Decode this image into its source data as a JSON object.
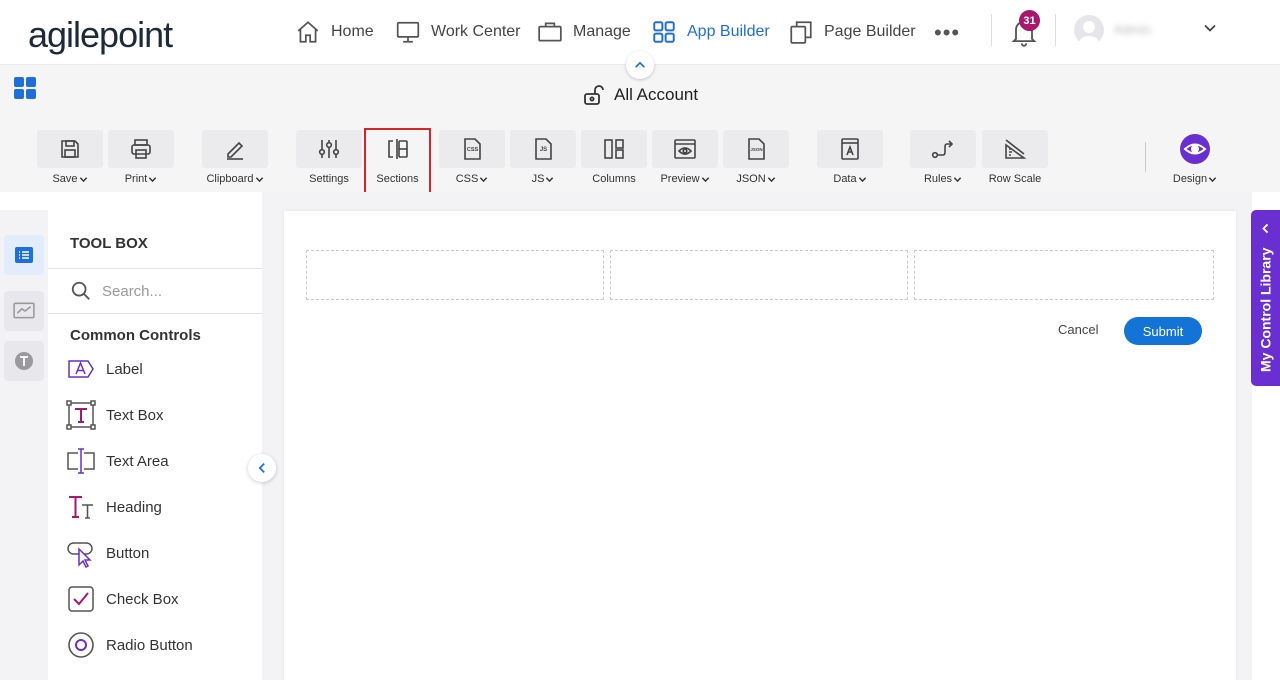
{
  "brand": {
    "logo_text": "agilepoint"
  },
  "nav": {
    "items": [
      {
        "label": "Home",
        "icon": "home-icon"
      },
      {
        "label": "Work Center",
        "icon": "monitor-icon"
      },
      {
        "label": "Manage",
        "icon": "briefcase-icon"
      },
      {
        "label": "App Builder",
        "icon": "grid-icon",
        "active": true
      },
      {
        "label": "Page Builder",
        "icon": "pages-icon"
      }
    ],
    "more": "•••",
    "notifications_count": "31",
    "username": "Admin"
  },
  "form_title": "All Account",
  "toolbar": {
    "items": [
      {
        "label": "Save",
        "icon": "save-icon",
        "dropdown": true
      },
      {
        "label": "Print",
        "icon": "print-icon",
        "dropdown": true
      },
      {
        "label": "Clipboard",
        "icon": "pencil-icon",
        "dropdown": true
      },
      {
        "label": "Settings",
        "icon": "sliders-icon",
        "dropdown": false
      },
      {
        "label": "Sections",
        "icon": "sections-icon",
        "dropdown": false,
        "selected": true
      },
      {
        "label": "CSS",
        "icon": "css-file-icon",
        "dropdown": true
      },
      {
        "label": "JS",
        "icon": "js-file-icon",
        "dropdown": true
      },
      {
        "label": "Columns",
        "icon": "columns-icon",
        "dropdown": false
      },
      {
        "label": "Preview",
        "icon": "preview-icon",
        "dropdown": true
      },
      {
        "label": "JSON",
        "icon": "json-file-icon",
        "dropdown": true
      },
      {
        "label": "Data",
        "icon": "data-icon",
        "dropdown": true
      },
      {
        "label": "Rules",
        "icon": "rules-icon",
        "dropdown": true
      },
      {
        "label": "Row Scale",
        "icon": "ruler-icon",
        "dropdown": false
      }
    ],
    "design_label": "Design"
  },
  "toolbox": {
    "title": "TOOL BOX",
    "search_placeholder": "Search...",
    "category": "Common Controls",
    "controls": [
      {
        "label": "Label",
        "icon": "label-icon"
      },
      {
        "label": "Text Box",
        "icon": "textbox-icon"
      },
      {
        "label": "Text Area",
        "icon": "textarea-icon"
      },
      {
        "label": "Heading",
        "icon": "heading-icon"
      },
      {
        "label": "Button",
        "icon": "button-icon"
      },
      {
        "label": "Check Box",
        "icon": "checkbox-icon"
      },
      {
        "label": "Radio Button",
        "icon": "radio-icon"
      }
    ]
  },
  "form": {
    "cancel_label": "Cancel",
    "submit_label": "Submit"
  },
  "right_panel": {
    "label": "My Control Library"
  },
  "colors": {
    "accent": "#1e6fd9",
    "purple": "#6a2fd0",
    "badge": "#a8176b",
    "selected_border": "#d4262a"
  }
}
